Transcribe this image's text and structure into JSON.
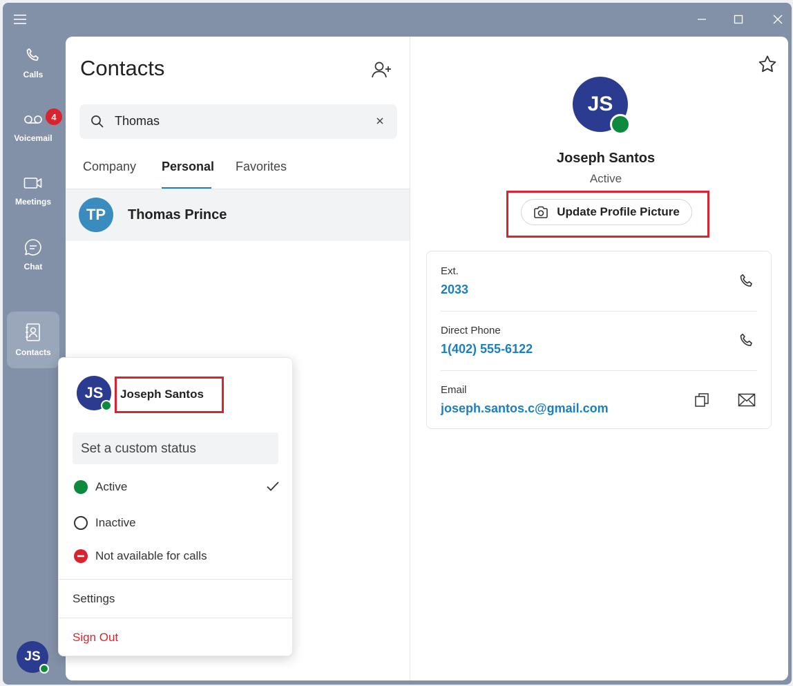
{
  "colors": {
    "accent": "#1a7fc1",
    "brand_avatar": "#2b3b8f",
    "online": "#0e8a3e",
    "danger": "#d9232e",
    "sidebar": "#8391a8"
  },
  "nav": {
    "items": [
      {
        "label": "Calls",
        "icon": "phone-icon"
      },
      {
        "label": "Voicemail",
        "icon": "voicemail-icon",
        "badge": "4"
      },
      {
        "label": "Meetings",
        "icon": "video-icon"
      },
      {
        "label": "Chat",
        "icon": "chat-icon"
      },
      {
        "label": "Contacts",
        "icon": "contact-book-icon",
        "active": true
      }
    ],
    "user_initials": "JS"
  },
  "contacts": {
    "title": "Contacts",
    "search_value": "Thomas",
    "tabs": [
      {
        "label": "Company"
      },
      {
        "label": "Personal",
        "active": true
      },
      {
        "label": "Favorites"
      }
    ],
    "results": [
      {
        "initials": "TP",
        "name": "Thomas Prince"
      }
    ]
  },
  "profile": {
    "initials": "JS",
    "name": "Joseph Santos",
    "status": "Active",
    "update_button": "Update Profile Picture",
    "fields": [
      {
        "label": "Ext.",
        "value": "2033"
      },
      {
        "label": "Direct Phone",
        "value": "1(402) 555-6122"
      },
      {
        "label": "Email",
        "value": "joseph.santos.c@gmail.com"
      }
    ]
  },
  "popup": {
    "initials": "JS",
    "name": "Joseph Santos",
    "custom_status_placeholder": "Set a custom status",
    "statuses": [
      {
        "label": "Active",
        "selected": true
      },
      {
        "label": "Inactive"
      },
      {
        "label": "Not available for calls"
      }
    ],
    "settings": "Settings",
    "sign_out": "Sign Out"
  }
}
